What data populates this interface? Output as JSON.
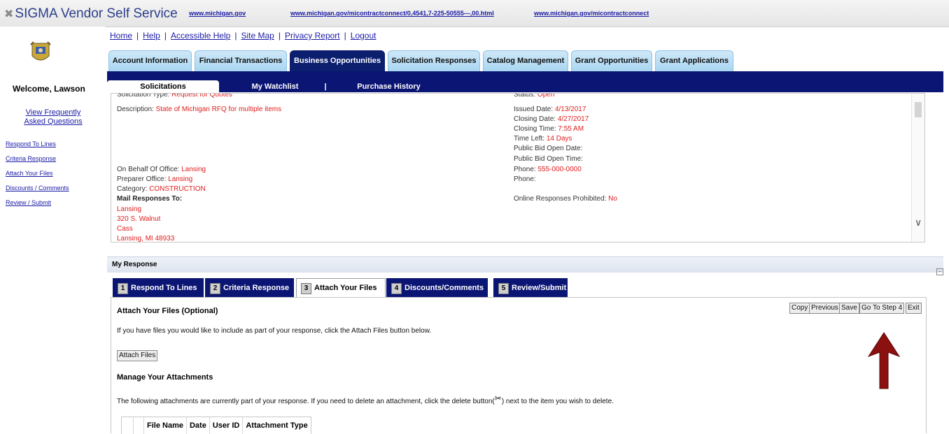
{
  "topbar": {
    "app_title": "SIGMA Vendor Self Service",
    "links": [
      "www.michigan.gov",
      "www.michigan.gov/micontractconnect/0,4541,7-225-50555---,00.html",
      "www.michigan.gov/micontractconnect"
    ]
  },
  "sidebar": {
    "welcome": "Welcome, Lawson",
    "faq": "View Frequently Asked Questions",
    "steps": [
      "Respond To Lines",
      "Criteria Response",
      "Attach Your Files",
      "Discounts / Comments",
      "Review / Submit"
    ]
  },
  "nav": {
    "links": [
      "Home",
      "Help",
      "Accessible Help",
      "Site Map",
      "Privacy Report",
      "Logout"
    ],
    "tabs": [
      "Account Information",
      "Financial Transactions",
      "Business Opportunities",
      "Solicitation Responses",
      "Catalog Management",
      "Grant Opportunities",
      "Grant Applications"
    ],
    "active_tab": "Business Opportunities",
    "subtabs": [
      "Solicitations",
      "My Watchlist",
      "|",
      "Purchase History"
    ]
  },
  "detail": {
    "top_clipped_left_label": "Solicitation Type:",
    "top_clipped_left_value": "Request for Quotes",
    "top_clipped_right_label": "Status:",
    "top_clipped_right_value": "Open",
    "description_label": "Description:",
    "description_value": "State of Michigan RFQ for multiple items",
    "on_behalf_label": "On Behalf Of Office:",
    "on_behalf_value": "Lansing",
    "preparer_label": "Preparer Office:",
    "preparer_value": "Lansing",
    "category_label": "Category:",
    "category_value": "CONSTRUCTION",
    "mail_label": "Mail Responses To:",
    "mail_lines": [
      "Lansing",
      "320 S. Walnut",
      "Cass",
      "Lansing, MI 48933"
    ],
    "issued_label": "Issued Date:",
    "issued_value": "4/13/2017",
    "closing_date_label": "Closing Date:",
    "closing_date_value": "4/27/2017",
    "closing_time_label": "Closing Time:",
    "closing_time_value": "7:55 AM",
    "time_left_label": "Time Left:",
    "time_left_value": "14 Days",
    "bid_open_date_label": "Public Bid Open Date:",
    "bid_open_time_label": "Public Bid Open Time:",
    "phone1_label": "Phone:",
    "phone1_value": "555-000-0000",
    "phone2_label": "Phone:",
    "online_label": "Online Responses Prohibited:",
    "online_value": "No"
  },
  "response": {
    "header": "My Response",
    "steps": [
      {
        "num": "1",
        "label": "Respond To Lines"
      },
      {
        "num": "2",
        "label": "Criteria Response"
      },
      {
        "num": "3",
        "label": "Attach Your Files"
      },
      {
        "num": "4",
        "label": "Discounts/Comments"
      },
      {
        "num": "5",
        "label": "Review/Submit"
      }
    ],
    "active_step": 3,
    "title": "Attach Your Files (Optional)",
    "instructions": "If you have files you would like to include as part of your response, click the Attach Files button below.",
    "attach_button": "Attach Files",
    "manage_title": "Manage Your Attachments",
    "manage_text_before": "The following attachments are currently part of your response. If you need to delete an attachment, click the delete button(",
    "manage_text_after": ") next to the item you wish to delete.",
    "actions": [
      "Copy",
      "Previous",
      "Save",
      "Go To Step 4",
      "Exit"
    ],
    "columns": [
      "File Name",
      "Date",
      "User ID",
      "Attachment Type"
    ]
  },
  "colors": {
    "navy": "#0b1573",
    "tab_blue": "#a8d6f2",
    "value_red": "#e01e1e",
    "link_blue": "#1a1aa6",
    "arrow_red": "#8b1010"
  },
  "icons": {
    "logo": "sigma-x-icon",
    "seal": "michigan-seal-icon",
    "delete": "scissors-icon",
    "annotation": "red-up-arrow"
  }
}
